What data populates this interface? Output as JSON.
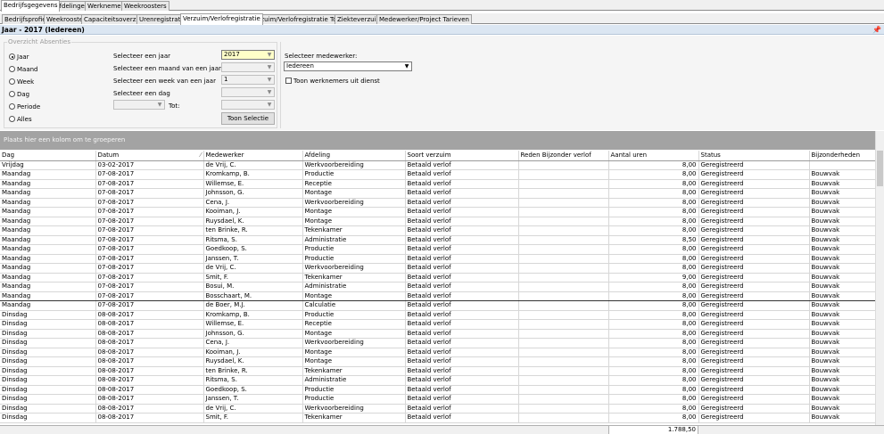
{
  "main_tabs": [
    "Bedrijfsgegevens",
    "Afdelingen",
    "Werknemers",
    "Weekroosters"
  ],
  "sub_tabs": [
    "Bedrijfsprofiel",
    "Weekrooster",
    "Capaciteitsoverzicht",
    "Urenregistratie",
    "Verzuim/Verlofregistratie",
    "Verzuim/Verlofregistratie Totalen",
    "Ziekteverzuim",
    "Medewerker/Project Tarieven"
  ],
  "title": "Jaar - 2017 (Iedereen)",
  "pin_icon": "📌",
  "filter": {
    "group_label": "Overzicht Absenties",
    "radios": [
      "Jaar",
      "Maand",
      "Week",
      "Dag",
      "Periode",
      "Alles"
    ],
    "selected_radio": "Jaar",
    "labels": {
      "year": "Selecteer een jaar",
      "month": "Selecteer een maand van een jaar",
      "week": "Selecteer een week van een jaar",
      "day": "Selecteer een dag",
      "tot": "Tot:",
      "employee": "Selecteer medewerker:"
    },
    "year_value": "2017",
    "week_value": "1",
    "employee_value": "Iedereen",
    "show_button": "Toon Selectie",
    "checkbox_label": "Toon werknemers uit dienst"
  },
  "group_hint": "Plaats hier een kolom om te groeperen",
  "columns": [
    "Dag",
    "Datum",
    "Medewerker",
    "Afdeling",
    "Soort verzuim",
    "Reden Bijzonder verlof",
    "Aantal uren",
    "Status",
    "Bijzonderheden"
  ],
  "rows": [
    [
      "Vrijdag",
      "03-02-2017",
      "de Vrij, C.",
      "Werkvoorbereiding",
      "Betaald verlof",
      "",
      "8,00",
      "Geregistreerd",
      ""
    ],
    [
      "Maandag",
      "07-08-2017",
      "Kromkamp, B.",
      "Productie",
      "Betaald verlof",
      "",
      "8,00",
      "Geregistreerd",
      "Bouwvak"
    ],
    [
      "Maandag",
      "07-08-2017",
      "Willemse, E.",
      "Receptie",
      "Betaald verlof",
      "",
      "8,00",
      "Geregistreerd",
      "Bouwvak"
    ],
    [
      "Maandag",
      "07-08-2017",
      "Johnsson, G.",
      "Montage",
      "Betaald verlof",
      "",
      "8,00",
      "Geregistreerd",
      "Bouwvak"
    ],
    [
      "Maandag",
      "07-08-2017",
      "Cena, J.",
      "Werkvoorbereiding",
      "Betaald verlof",
      "",
      "8,00",
      "Geregistreerd",
      "Bouwvak"
    ],
    [
      "Maandag",
      "07-08-2017",
      "Kooiman, J.",
      "Montage",
      "Betaald verlof",
      "",
      "8,00",
      "Geregistreerd",
      "Bouwvak"
    ],
    [
      "Maandag",
      "07-08-2017",
      "Ruysdael, K.",
      "Montage",
      "Betaald verlof",
      "",
      "8,00",
      "Geregistreerd",
      "Bouwvak"
    ],
    [
      "Maandag",
      "07-08-2017",
      "ten Brinke, R.",
      "Tekenkamer",
      "Betaald verlof",
      "",
      "8,00",
      "Geregistreerd",
      "Bouwvak"
    ],
    [
      "Maandag",
      "07-08-2017",
      "Ritsma, S.",
      "Administratie",
      "Betaald verlof",
      "",
      "8,50",
      "Geregistreerd",
      "Bouwvak"
    ],
    [
      "Maandag",
      "07-08-2017",
      "Goedkoop, S.",
      "Productie",
      "Betaald verlof",
      "",
      "8,00",
      "Geregistreerd",
      "Bouwvak"
    ],
    [
      "Maandag",
      "07-08-2017",
      "Janssen, T.",
      "Productie",
      "Betaald verlof",
      "",
      "8,00",
      "Geregistreerd",
      "Bouwvak"
    ],
    [
      "Maandag",
      "07-08-2017",
      "de Vrij, C.",
      "Werkvoorbereiding",
      "Betaald verlof",
      "",
      "8,00",
      "Geregistreerd",
      "Bouwvak"
    ],
    [
      "Maandag",
      "07-08-2017",
      "Smit, F.",
      "Tekenkamer",
      "Betaald verlof",
      "",
      "9,00",
      "Geregistreerd",
      "Bouwvak"
    ],
    [
      "Maandag",
      "07-08-2017",
      "Bosui, M.",
      "Administratie",
      "Betaald verlof",
      "",
      "8,00",
      "Geregistreerd",
      "Bouwvak"
    ],
    [
      "Maandag",
      "07-08-2017",
      "Bosschaart, M.",
      "Montage",
      "Betaald verlof",
      "",
      "8,00",
      "Geregistreerd",
      "Bouwvak"
    ],
    [
      "Maandag",
      "07-08-2017",
      "de Boer, M.J.",
      "Calculatie",
      "Betaald verlof",
      "",
      "8,00",
      "Geregistreerd",
      "Bouwvak"
    ],
    [
      "Dinsdag",
      "08-08-2017",
      "Kromkamp, B.",
      "Productie",
      "Betaald verlof",
      "",
      "8,00",
      "Geregistreerd",
      "Bouwvak"
    ],
    [
      "Dinsdag",
      "08-08-2017",
      "Willemse, E.",
      "Receptie",
      "Betaald verlof",
      "",
      "8,00",
      "Geregistreerd",
      "Bouwvak"
    ],
    [
      "Dinsdag",
      "08-08-2017",
      "Johnsson, G.",
      "Montage",
      "Betaald verlof",
      "",
      "8,00",
      "Geregistreerd",
      "Bouwvak"
    ],
    [
      "Dinsdag",
      "08-08-2017",
      "Cena, J.",
      "Werkvoorbereiding",
      "Betaald verlof",
      "",
      "8,00",
      "Geregistreerd",
      "Bouwvak"
    ],
    [
      "Dinsdag",
      "08-08-2017",
      "Kooiman, J.",
      "Montage",
      "Betaald verlof",
      "",
      "8,00",
      "Geregistreerd",
      "Bouwvak"
    ],
    [
      "Dinsdag",
      "08-08-2017",
      "Ruysdael, K.",
      "Montage",
      "Betaald verlof",
      "",
      "8,00",
      "Geregistreerd",
      "Bouwvak"
    ],
    [
      "Dinsdag",
      "08-08-2017",
      "ten Brinke, R.",
      "Tekenkamer",
      "Betaald verlof",
      "",
      "8,00",
      "Geregistreerd",
      "Bouwvak"
    ],
    [
      "Dinsdag",
      "08-08-2017",
      "Ritsma, S.",
      "Administratie",
      "Betaald verlof",
      "",
      "8,00",
      "Geregistreerd",
      "Bouwvak"
    ],
    [
      "Dinsdag",
      "08-08-2017",
      "Goedkoop, S.",
      "Productie",
      "Betaald verlof",
      "",
      "8,00",
      "Geregistreerd",
      "Bouwvak"
    ],
    [
      "Dinsdag",
      "08-08-2017",
      "Janssen, T.",
      "Productie",
      "Betaald verlof",
      "",
      "8,00",
      "Geregistreerd",
      "Bouwvak"
    ],
    [
      "Dinsdag",
      "08-08-2017",
      "de Vrij, C.",
      "Werkvoorbereiding",
      "Betaald verlof",
      "",
      "8,00",
      "Geregistreerd",
      "Bouwvak"
    ],
    [
      "Dinsdag",
      "08-08-2017",
      "Smit, F.",
      "Tekenkamer",
      "Betaald verlof",
      "",
      "8,00",
      "Geregistreerd",
      "Bouwvak"
    ]
  ],
  "selected_row": 14,
  "total_hours": "1.788,50"
}
